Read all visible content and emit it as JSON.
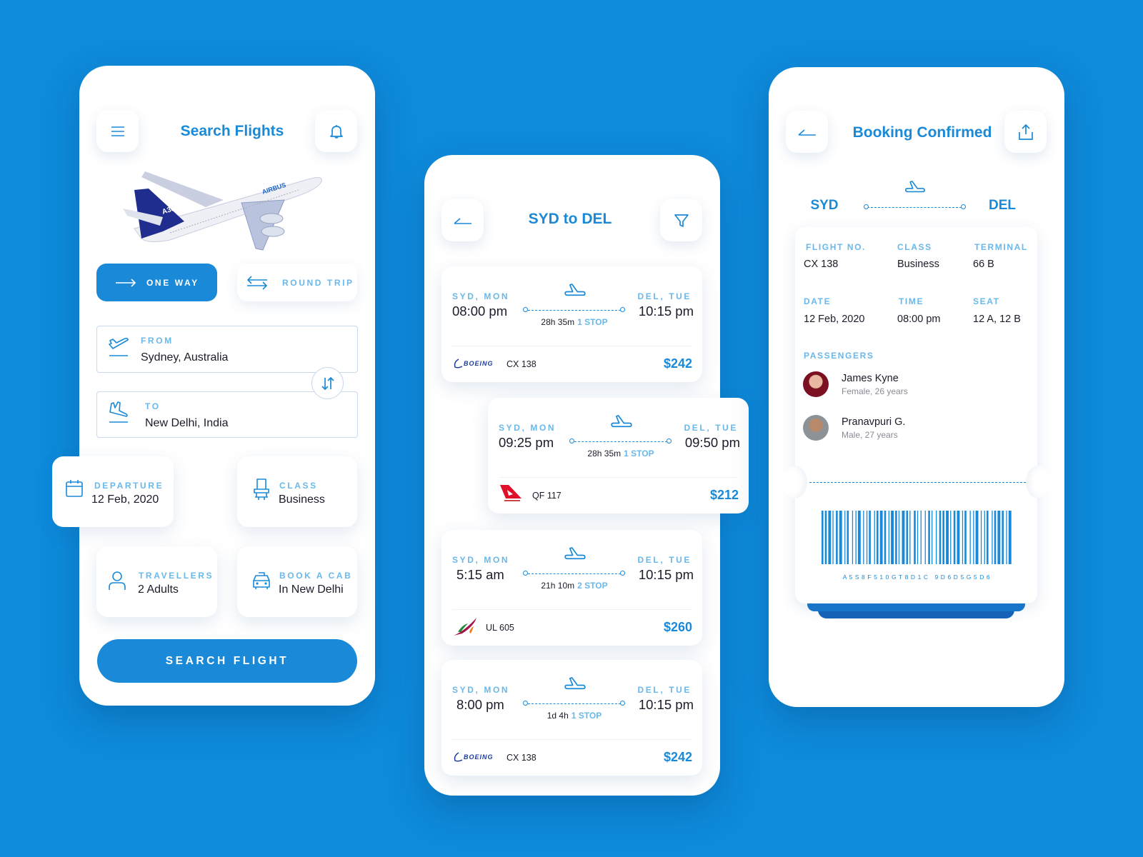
{
  "colors": {
    "background": "#0e8bdb",
    "accent": "#1a8ad8",
    "label": "#6ab8ea"
  },
  "search": {
    "title": "Search Flights",
    "menu_icon": "hamburger-menu-icon",
    "bell_icon": "bell-icon",
    "trip_types": [
      {
        "label": "ONE WAY",
        "selected": true
      },
      {
        "label": "ROUND TRIP",
        "selected": false
      }
    ],
    "from": {
      "label": "FROM",
      "value": "Sydney, Australia"
    },
    "to": {
      "label": "TO",
      "value": "New Delhi, India"
    },
    "departure": {
      "label": "DEPARTURE",
      "value": "12 Feb, 2020"
    },
    "class": {
      "label": "CLASS",
      "value": "Business"
    },
    "travellers": {
      "label": "TRAVELLERS",
      "value": "2 Adults"
    },
    "cab": {
      "label": "BOOK A CAB",
      "value": "In New Delhi"
    },
    "search_button": "SEARCH FLIGHT",
    "image_lettering": "A380 AIRBUS"
  },
  "results": {
    "title": "SYD to DEL",
    "flights": [
      {
        "from": "SYD, MON",
        "dep": "08:00 pm",
        "to": "DEL, TUE",
        "arr": "10:15 pm",
        "duration": "28h 35m",
        "stops": "1 STOP",
        "airline_logo": "BOEING",
        "flight_no": "CX 138",
        "price": "$242"
      },
      {
        "from": "SYD, MON",
        "dep": "09:25 pm",
        "to": "DEL, TUE",
        "arr": "09:50 pm",
        "duration": "28h 35m",
        "stops": "1 STOP",
        "airline_logo": "QANTAS",
        "flight_no": "QF 117",
        "price": "$212"
      },
      {
        "from": "SYD, MON",
        "dep": "5:15 am",
        "to": "DEL, TUE",
        "arr": "10:15 pm",
        "duration": "21h 10m",
        "stops": "2 STOP",
        "airline_logo": "SriLankan",
        "flight_no": "UL 605",
        "price": "$260"
      },
      {
        "from": "SYD, MON",
        "dep": "8:00 pm",
        "to": "DEL, TUE",
        "arr": "10:15 pm",
        "duration": "1d 4h",
        "stops": "1 STOP",
        "airline_logo": "BOEING",
        "flight_no": "CX 138",
        "price": "$242"
      }
    ]
  },
  "booking": {
    "title": "Booking Confirmed",
    "origin": "SYD",
    "destination": "DEL",
    "fields": [
      {
        "label": "FLIGHT NO.",
        "value": "CX 138"
      },
      {
        "label": "CLASS",
        "value": "Business"
      },
      {
        "label": "TERMINAL",
        "value": "66 B"
      },
      {
        "label": "DATE",
        "value": "12 Feb, 2020"
      },
      {
        "label": "TIME",
        "value": "08:00 pm"
      },
      {
        "label": "SEAT",
        "value": "12 A, 12 B"
      }
    ],
    "passengers_label": "PASSENGERS",
    "passengers": [
      {
        "name": "James Kyne",
        "detail": "Female, 26 years"
      },
      {
        "name": "Pranavpuri G.",
        "detail": "Male, 27 years"
      }
    ],
    "barcode_text": "A 5 S 8 F 5 1 0 G T 8 D 1 C   9 D 6 D 5 G 5 D 6"
  }
}
